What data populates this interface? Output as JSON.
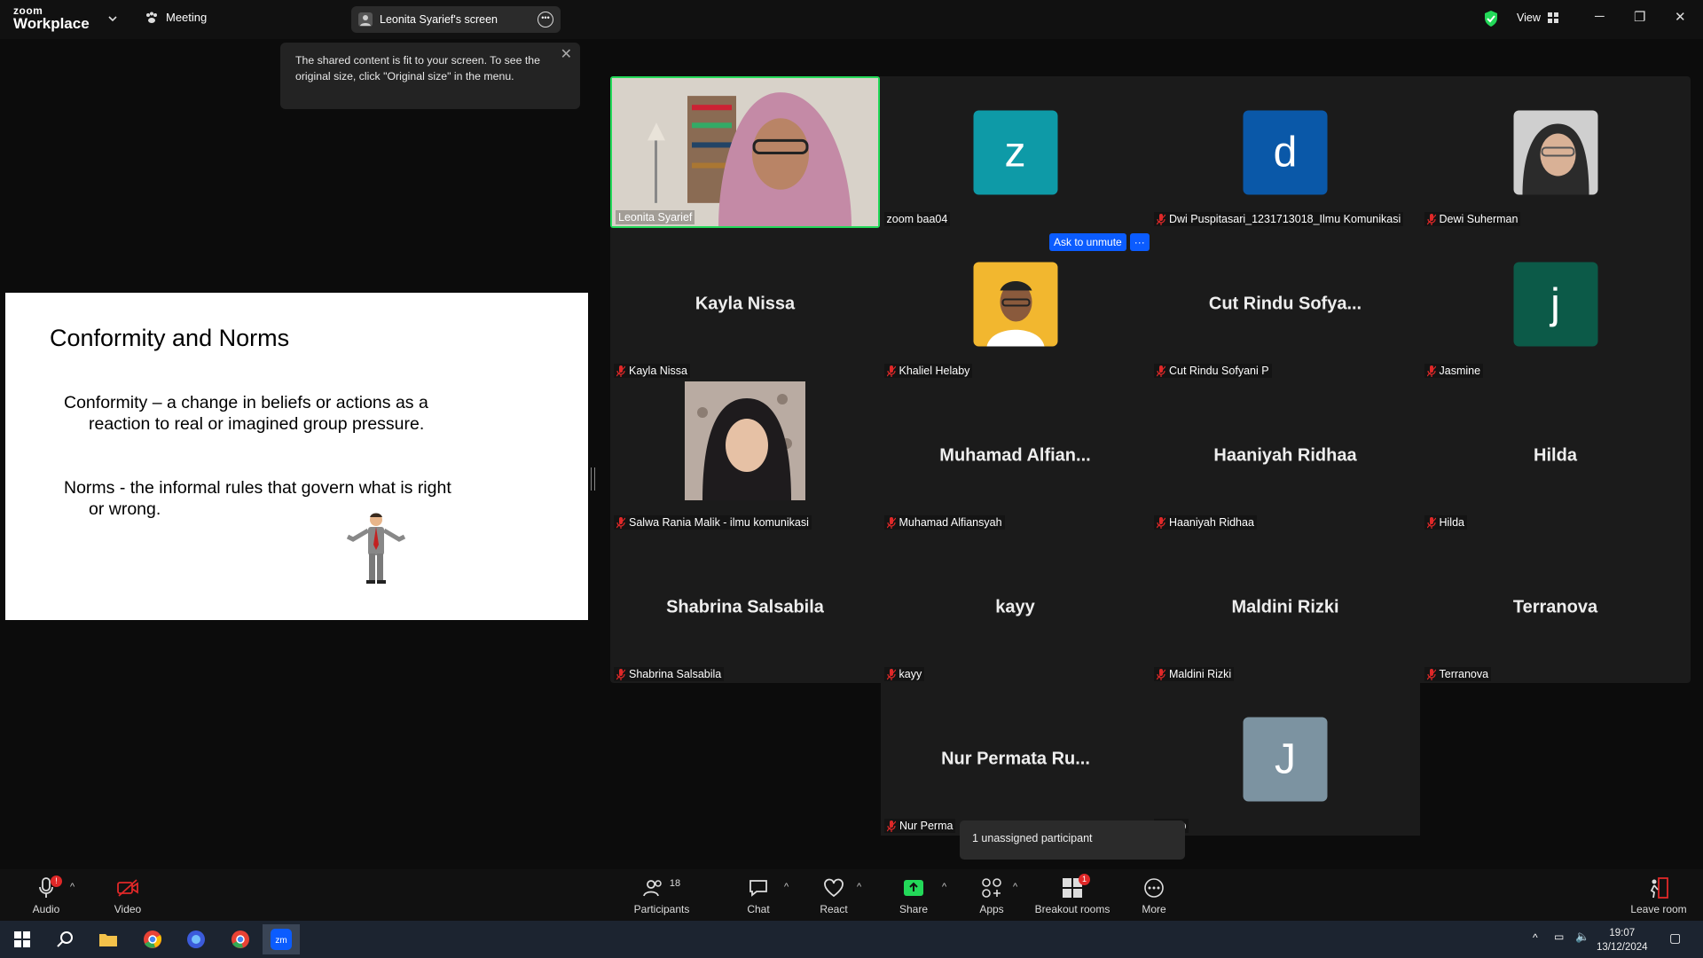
{
  "topbar": {
    "logo_small": "zoom",
    "logo_main": "Workplace",
    "meeting_label": "Meeting",
    "screen_label": "Leonita Syarief's screen",
    "view_label": "View"
  },
  "tooltip": {
    "text": "The shared content is fit to your screen. To see the original size, click \"Original size\" in the menu."
  },
  "slide": {
    "title": "Conformity and Norms",
    "p1_line1": "Conformity – a change in beliefs or actions as a",
    "p1_line2": "reaction to real or imagined group pressure.",
    "p2_line1": "Norms - the informal rules that govern what is right",
    "p2_line2": "or wrong."
  },
  "participants": [
    {
      "name": "Leonita Syarief",
      "kind": "video",
      "active": true,
      "muted": false
    },
    {
      "name": "zoom baa04",
      "kind": "avatar",
      "letter": "z",
      "color": "#0e9aa7",
      "muted": false
    },
    {
      "name": "Dwi Puspitasari_1231713018_Ilmu Komunikasi",
      "kind": "avatar",
      "letter": "d",
      "color": "#0a58a8",
      "muted": true
    },
    {
      "name": "Dewi Suherman",
      "kind": "photo",
      "muted": true
    },
    {
      "name": "Kayla Nissa",
      "kind": "text",
      "display": "Kayla Nissa",
      "muted": true
    },
    {
      "name": "Khaliel Helaby",
      "kind": "photo2",
      "muted": true
    },
    {
      "name": "Cut Rindu Sofyani P",
      "kind": "text",
      "display": "Cut Rindu Sofya...",
      "muted": true
    },
    {
      "name": "Jasmine",
      "kind": "avatar",
      "letter": "j",
      "color": "#0c5a48",
      "muted": true
    },
    {
      "name": "Salwa Rania Malik - ilmu komunikasi",
      "kind": "photo3",
      "muted": true
    },
    {
      "name": "Muhamad Alfiansyah",
      "kind": "text",
      "display": "Muhamad Alfian...",
      "muted": true
    },
    {
      "name": "Haaniyah Ridhaa",
      "kind": "text",
      "display": "Haaniyah Ridhaa",
      "muted": true
    },
    {
      "name": "Hilda",
      "kind": "text",
      "display": "Hilda",
      "muted": true
    },
    {
      "name": "Shabrina Salsabila",
      "kind": "text",
      "display": "Shabrina Salsabila",
      "muted": true
    },
    {
      "name": "kayy",
      "kind": "text",
      "display": "kayy",
      "muted": true
    },
    {
      "name": "Maldini Rizki",
      "kind": "text",
      "display": "Maldini Rizki",
      "muted": true
    },
    {
      "name": "Terranova",
      "kind": "text",
      "display": "Terranova",
      "muted": true
    },
    {
      "name": "Nur Perma",
      "kind": "text",
      "display": "Nur Permata Ru...",
      "muted": true
    },
    {
      "name": "nsyhp",
      "kind": "avatar",
      "letter": "J",
      "color": "#7c93a1",
      "muted": false
    }
  ],
  "ask_unmute": {
    "label": "Ask to unmute",
    "more": "···"
  },
  "unassigned": {
    "text": "1 unassigned participant"
  },
  "toolbar": {
    "audio": "Audio",
    "video": "Video",
    "participants": "Participants",
    "participants_count": "18",
    "chat": "Chat",
    "react": "React",
    "share": "Share",
    "apps": "Apps",
    "breakout": "Breakout rooms",
    "breakout_badge": "1",
    "more": "More",
    "leave": "Leave room",
    "audio_badge": "!"
  },
  "clock": {
    "time": "19:07",
    "date": "13/12/2024"
  },
  "colors": {
    "active_border": "#23d959",
    "primary": "#0b5cff",
    "share_green": "#23d959",
    "danger": "#e02828"
  }
}
